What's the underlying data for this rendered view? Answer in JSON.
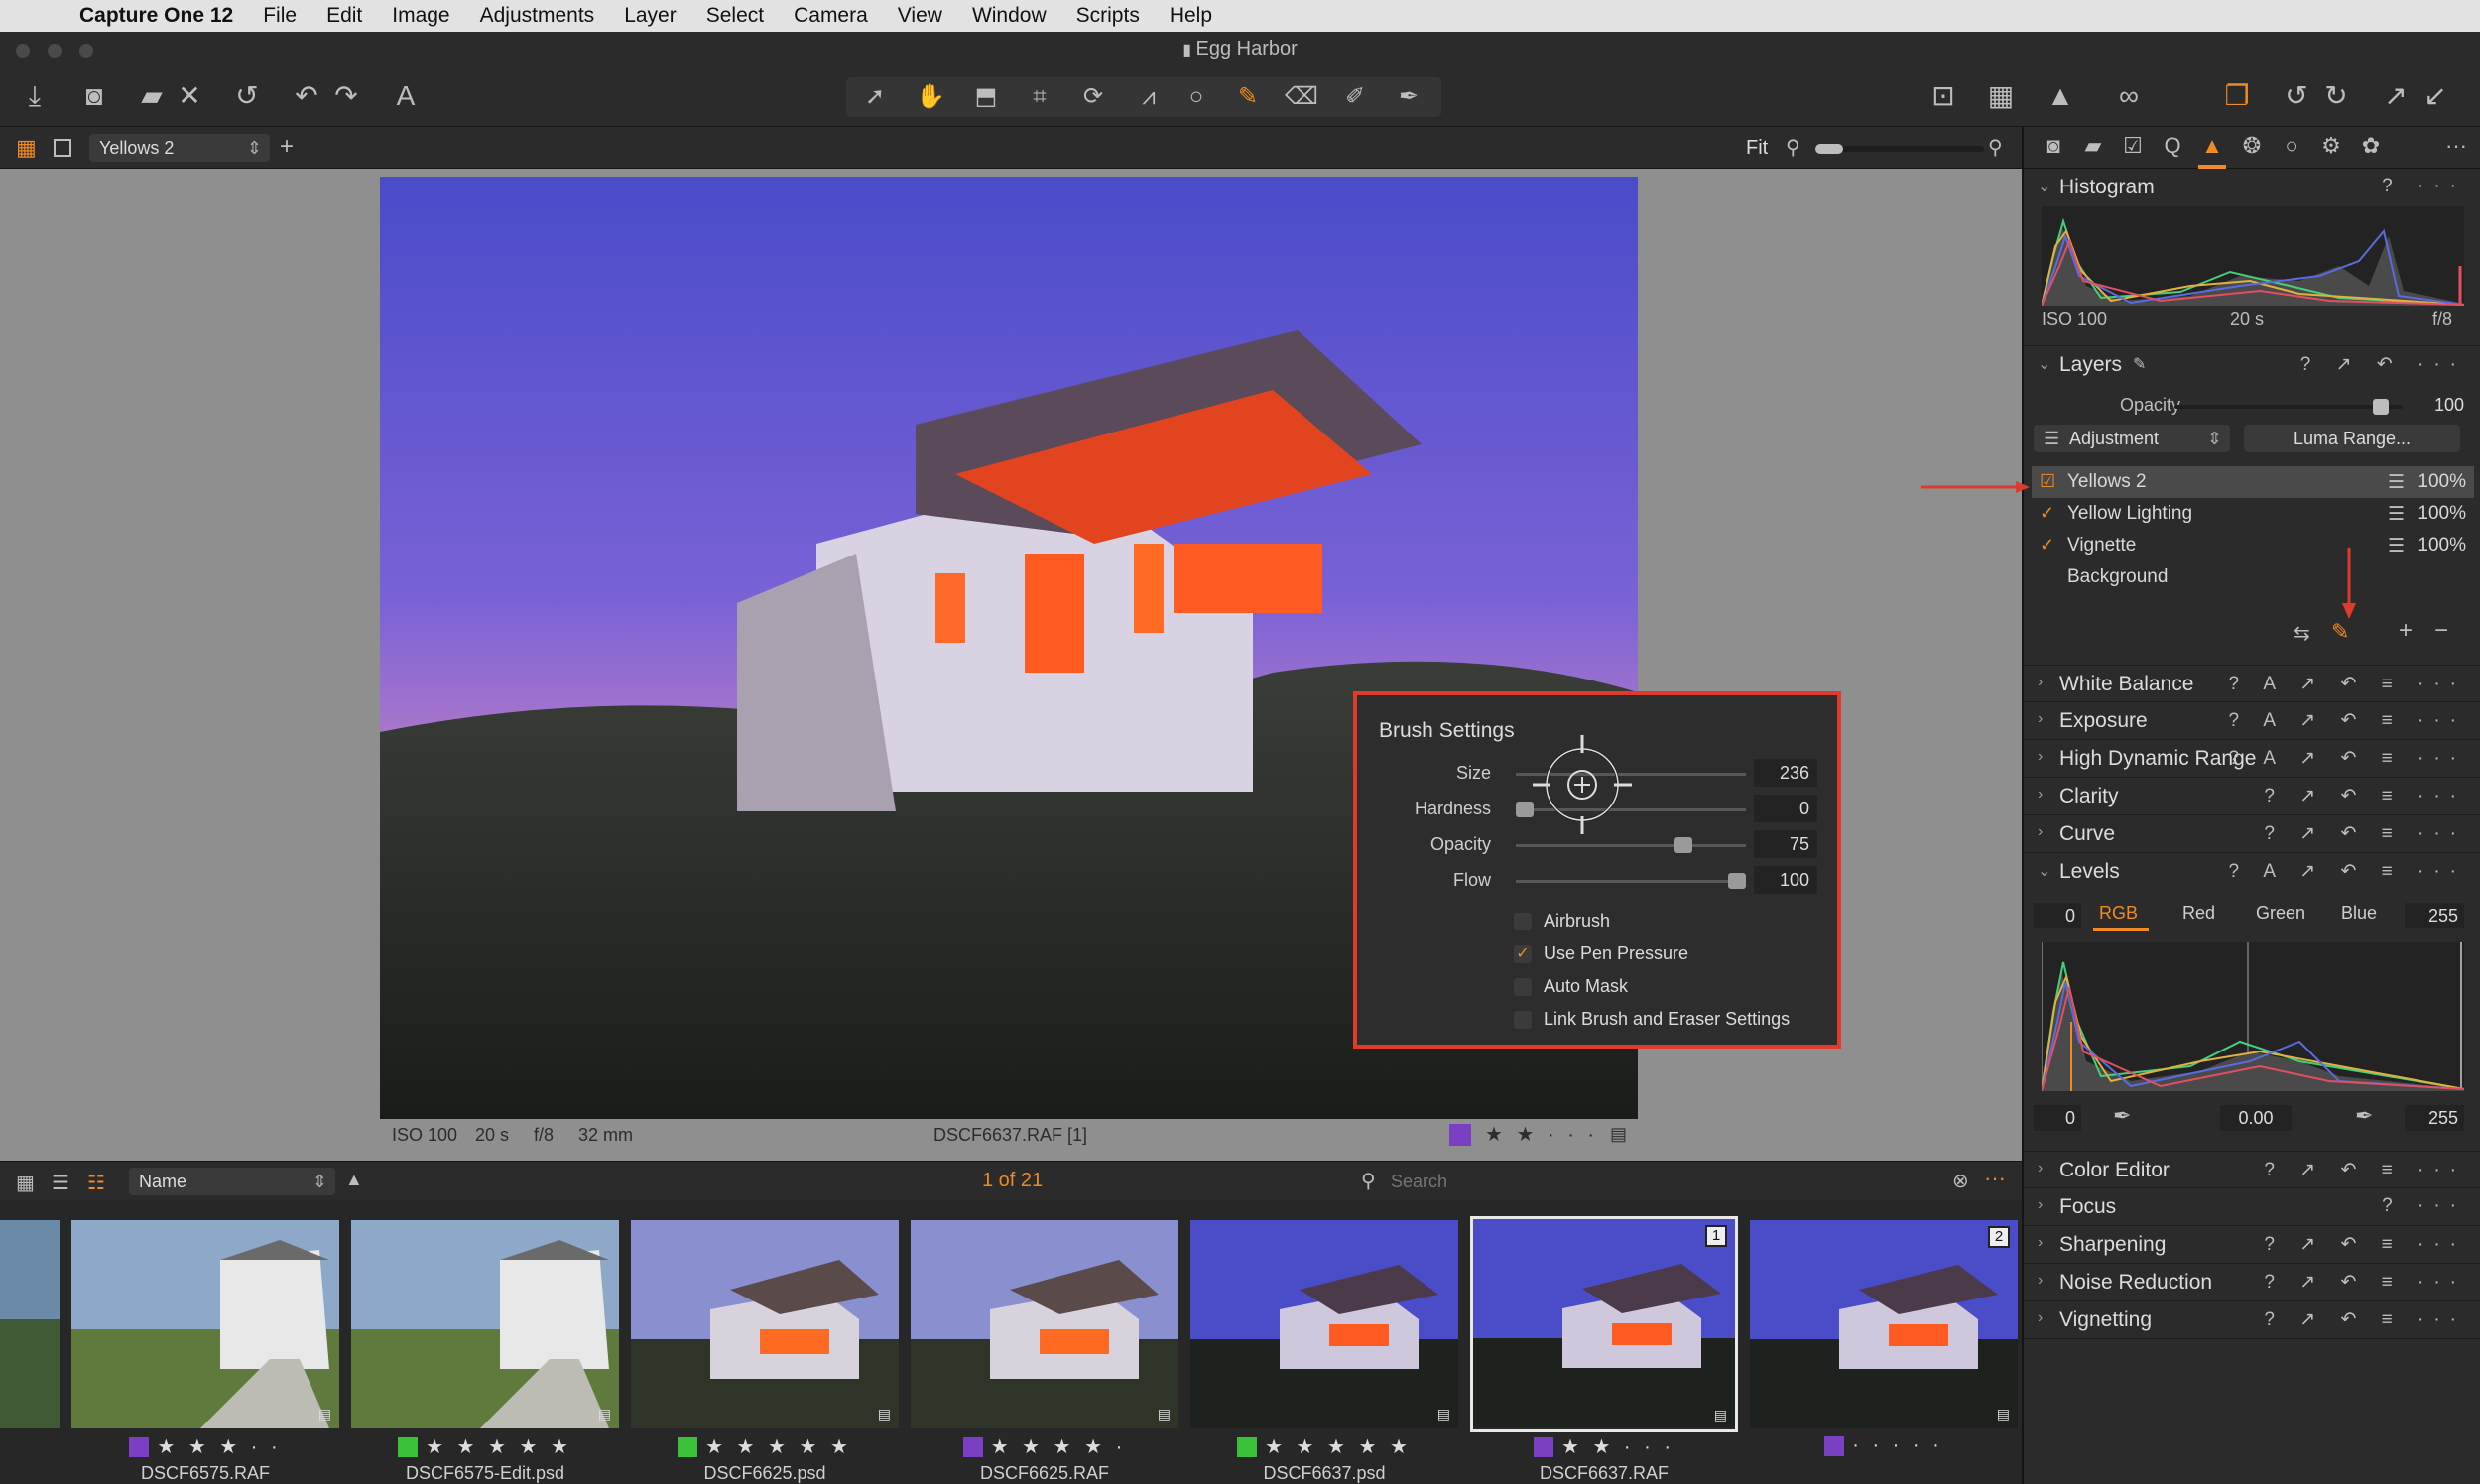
{
  "menubar": {
    "app_name": "Capture One 12",
    "items": [
      "File",
      "Edit",
      "Image",
      "Adjustments",
      "Layer",
      "Select",
      "Camera",
      "View",
      "Window",
      "Scripts",
      "Help"
    ]
  },
  "window": {
    "title": "Egg Harbor"
  },
  "viewer": {
    "variant_select": "Yellows 2",
    "zoom_label": "Fit",
    "info": {
      "iso": "ISO 100",
      "shutter": "20 s",
      "aperture": "f/8",
      "focal": "32 mm",
      "filename": "DSCF6637.RAF [1]"
    },
    "rating_stars": "★ ★ · · ·",
    "color_tag": "#7b3fc4"
  },
  "brush_settings": {
    "title": "Brush Settings",
    "sliders": [
      {
        "label": "Size",
        "value": "236",
        "fraction": 0.2
      },
      {
        "label": "Hardness",
        "value": "0",
        "fraction": 0.0
      },
      {
        "label": "Opacity",
        "value": "75",
        "fraction": 0.72
      },
      {
        "label": "Flow",
        "value": "100",
        "fraction": 1.0
      }
    ],
    "options": [
      {
        "label": "Airbrush",
        "checked": false
      },
      {
        "label": "Use Pen Pressure",
        "checked": true
      },
      {
        "label": "Auto Mask",
        "checked": false
      },
      {
        "label": "Link Brush and Eraser Settings",
        "checked": false
      }
    ]
  },
  "browser": {
    "sort_select": "Name",
    "count": "1 of 21",
    "search_placeholder": "Search",
    "thumbnails": [
      {
        "filename": "DSCF6575.RAF",
        "stars": "★ ★ ★ · ·",
        "color": "#7b3fc4",
        "scene": "day"
      },
      {
        "filename": "DSCF6575-Edit.psd",
        "stars": "★ ★ ★ ★ ★",
        "color": "#3cc13b",
        "scene": "day"
      },
      {
        "filename": "DSCF6625.psd",
        "stars": "★ ★ ★ ★ ★",
        "color": "#3cc13b",
        "scene": "dusk"
      },
      {
        "filename": "DSCF6625.RAF",
        "stars": "★ ★ ★ ★ ·",
        "color": "#7b3fc4",
        "scene": "dusk"
      },
      {
        "filename": "DSCF6637.psd",
        "stars": "★ ★ ★ ★ ★",
        "color": "#3cc13b",
        "scene": "night"
      },
      {
        "filename": "DSCF6637.RAF",
        "stars": "★ ★ · · ·",
        "color": "#7b3fc4",
        "scene": "night",
        "badge": "1"
      },
      {
        "filename": "",
        "stars": "· · · · ·",
        "color": "#7b3fc4",
        "scene": "night",
        "badge": "2"
      }
    ]
  },
  "sidebar": {
    "histogram": {
      "title": "Histogram",
      "iso": "ISO 100",
      "shutter": "20 s",
      "aperture": "f/8"
    },
    "layers": {
      "title": "Layers",
      "opacity_label": "Opacity",
      "opacity_value": "100",
      "adjustment_select": "Adjustment",
      "luma_button": "Luma Range...",
      "items": [
        {
          "name": "Yellows 2",
          "checked": true,
          "pct": "100%"
        },
        {
          "name": "Yellow Lighting",
          "checked": true,
          "pct": "100%"
        },
        {
          "name": "Vignette",
          "checked": true,
          "pct": "100%"
        },
        {
          "name": "Background",
          "checked": false,
          "pct": ""
        }
      ]
    },
    "tools": [
      {
        "name": "White Balance",
        "expanded": false
      },
      {
        "name": "Exposure",
        "expanded": false
      },
      {
        "name": "High Dynamic Range",
        "expanded": false
      },
      {
        "name": "Clarity",
        "expanded": false
      },
      {
        "name": "Curve",
        "expanded": false
      },
      {
        "name": "Levels",
        "expanded": true
      }
    ],
    "levels": {
      "tabs": [
        "RGB",
        "Red",
        "Green",
        "Blue"
      ],
      "input_low": "0",
      "input_high": "255",
      "output_low": "0",
      "output_mid": "0.00",
      "output_high": "255"
    },
    "tools_after": [
      {
        "name": "Color Editor"
      },
      {
        "name": "Focus"
      },
      {
        "name": "Sharpening"
      },
      {
        "name": "Noise Reduction"
      },
      {
        "name": "Vignetting"
      }
    ]
  },
  "colors": {
    "accent": "#f08a24",
    "highlight_box": "#e03a2c",
    "arrow": "#e03a2c"
  }
}
